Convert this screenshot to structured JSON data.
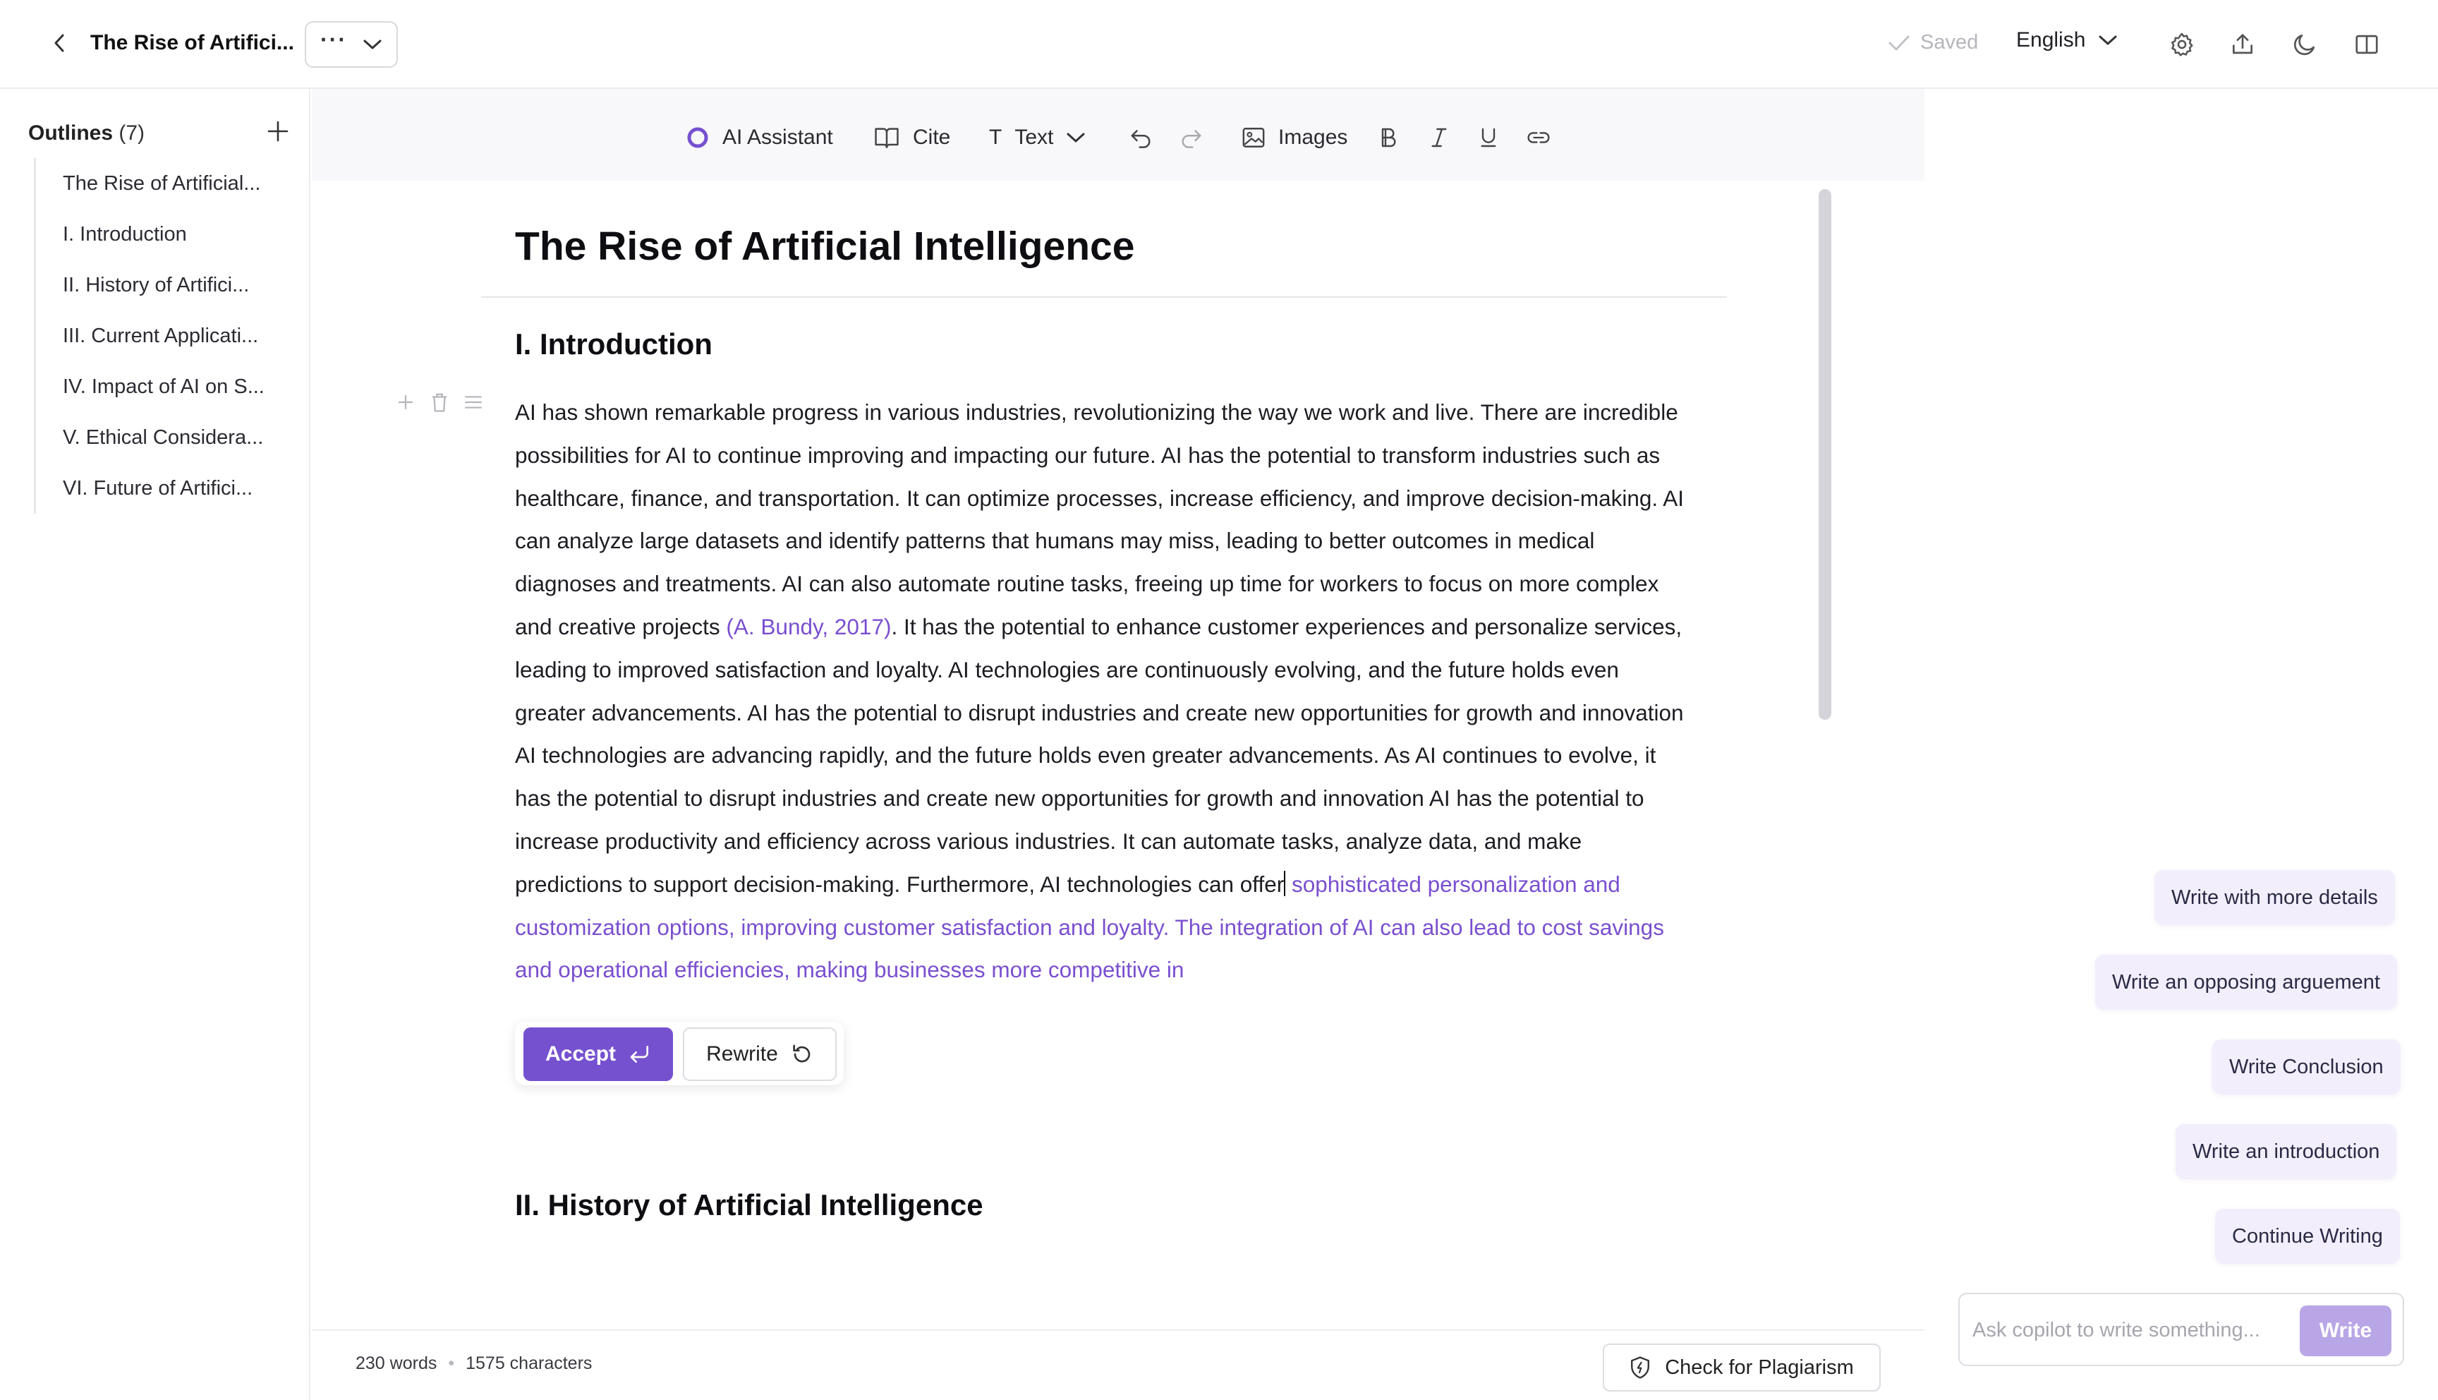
{
  "header": {
    "doc_title": "The Rise of Artifici...",
    "more_label": "···",
    "saved_label": "Saved",
    "language": "English"
  },
  "sidebar": {
    "title": "Outlines",
    "count": "(7)",
    "items": [
      {
        "label": "The Rise of Artificial..."
      },
      {
        "label": "I. Introduction"
      },
      {
        "label": "II. History of Artifici..."
      },
      {
        "label": "III. Current Applicati..."
      },
      {
        "label": "IV. Impact of AI on S..."
      },
      {
        "label": "V. Ethical Considera..."
      },
      {
        "label": "VI. Future of Artifici..."
      }
    ]
  },
  "toolbar": {
    "ai_assistant": "AI Assistant",
    "cite": "Cite",
    "text_glyph": "T",
    "text": "Text",
    "images": "Images"
  },
  "document": {
    "title": "The Rise of Artificial Intelligence",
    "section1_heading": "I. Introduction",
    "paragraph_main": "AI has shown remarkable progress in various industries, revolutionizing the way we work and live. There are incredible possibilities for AI to continue improving and impacting our future. AI has the potential to transform industries such as healthcare, finance, and transportation. It can optimize processes, increase efficiency, and improve decision-making. AI can analyze large datasets and identify patterns that humans may miss, leading to better outcomes in medical diagnoses and treatments. AI can also automate routine tasks, freeing up time for workers to focus on more complex and creative projects ",
    "citation": "(A. Bundy, 2017)",
    "paragraph_after_cite": ". It has the potential to enhance customer experiences and personalize services, leading to improved satisfaction and loyalty. AI technologies are continuously evolving, and the future holds even greater advancements. AI has the potential to disrupt industries and create new opportunities for growth and innovation AI technologies are advancing rapidly, and the future holds even greater advancements. As AI continues to evolve, it has the potential to disrupt industries and create new opportunities for growth and innovation AI has the potential to increase productivity and efficiency across various industries. It can automate tasks, analyze data, and make predictions to support decision-making. Furthermore, AI technologies can offer",
    "ai_suggestion": " sophisticated personalization and customization options, improving customer satisfaction and loyalty. The integration of AI can also lead to cost savings and operational efficiencies, making businesses more competitive in",
    "accept_label": "Accept",
    "rewrite_label": "Rewrite",
    "section2_heading": "II. History of Artificial Intelligence"
  },
  "status": {
    "words": "230 words",
    "separator": "•",
    "characters": "1575 characters",
    "plagiarism_label": "Check for Plagiarism"
  },
  "copilot": {
    "suggestions": [
      {
        "label": "Write with more details"
      },
      {
        "label": "Write an opposing arguement"
      },
      {
        "label": "Write Conclusion"
      },
      {
        "label": "Write an introduction"
      },
      {
        "label": "Continue Writing"
      }
    ],
    "placeholder": "Ask copilot to write something...",
    "write_label": "Write"
  },
  "colors": {
    "accent": "#7651cf",
    "suggestion_text": "#7a4fcf",
    "chip_bg": "#f2eefc"
  }
}
